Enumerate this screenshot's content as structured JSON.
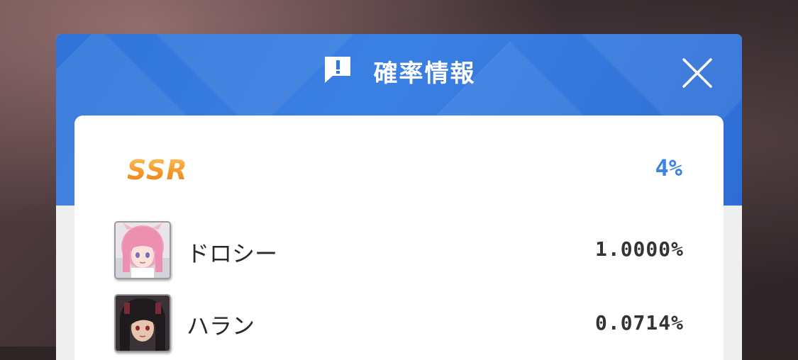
{
  "dialog": {
    "title": "確率情報",
    "icon": "info-exclamation-icon",
    "close_icon": "close-icon"
  },
  "rarity_section": {
    "rarity_label": "SSR",
    "rate": "4%"
  },
  "characters": [
    {
      "name": "ドロシー",
      "rate": "1.0000%",
      "portrait": "dorothy-portrait"
    },
    {
      "name": "ハラン",
      "rate": "0.0714%",
      "portrait": "harran-portrait"
    }
  ],
  "colors": {
    "header_blue": "#3178dc",
    "rate_blue": "#3f84e5",
    "ssr_orange": "#f39a2c"
  }
}
